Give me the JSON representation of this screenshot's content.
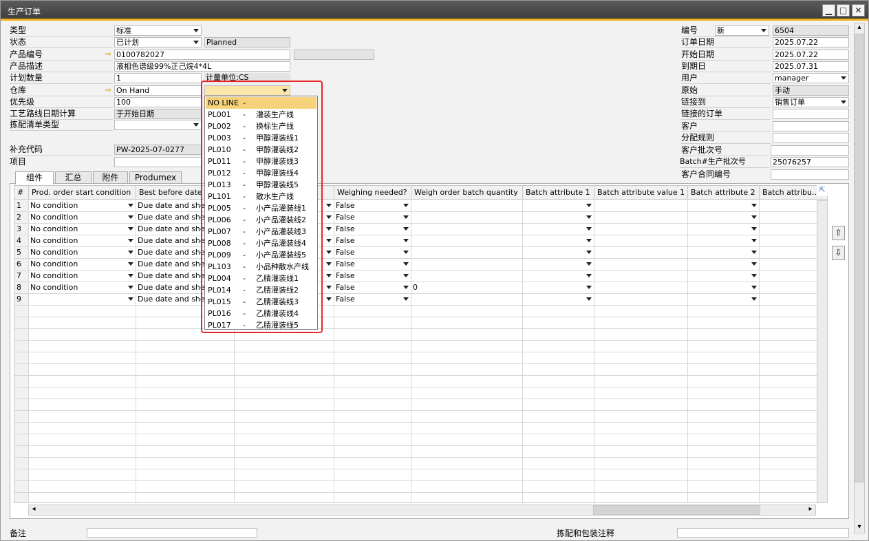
{
  "window": {
    "title": "生产订单",
    "minimize": "▁",
    "maximize": "□",
    "close": "✕"
  },
  "left_form": {
    "type_label": "类型",
    "type_value": "标准",
    "status_label": "状态",
    "status_value": "已计划",
    "status_text": "Planned",
    "product_no_label": "产品编号",
    "product_no_value": "0100782027",
    "product_desc_label": "产品描述",
    "product_desc_value": "液相色谱级99%正己烷4*4L",
    "planned_qty_label": "计划数量",
    "planned_qty_value": "1",
    "uom_label": "计量单位:CS",
    "warehouse_label": "仓库",
    "warehouse_value": "On Hand",
    "priority_label": "优先级",
    "priority_value": "100",
    "routing_date_label": "工艺路线日期计算",
    "routing_date_value": "于开始日期",
    "picklist_label": "拣配清单类型",
    "picklist_value": "",
    "supplement_label": "补充代码",
    "supplement_value": "PW-2025-07-0277",
    "project_label": "项目",
    "project_value": ""
  },
  "right_form": {
    "number_label": "编号",
    "series_value": "新",
    "number_value": "6504",
    "order_date_label": "订单日期",
    "order_date_value": "2025.07.22",
    "start_date_label": "开始日期",
    "start_date_value": "2025.07.22",
    "due_date_label": "到期日",
    "due_date_value": "2025.07.31",
    "user_label": "用户",
    "user_value": "manager",
    "origin_label": "原始",
    "origin_value": "手动",
    "link_to_label": "链接到",
    "link_to_value": "销售订单",
    "linked_order_label": "链接的订单",
    "linked_order_value": "",
    "customer_label": "客户",
    "customer_value": "",
    "dist_rule_label": "分配规则",
    "dist_rule_value": "",
    "cust_batch_label": "客户批次号",
    "cust_batch_value": "",
    "prod_batch_label": "Batch#生产批次号",
    "prod_batch_value": "25076257",
    "contract_label": "客户合同编号",
    "contract_value": ""
  },
  "tabs": [
    "组件",
    "汇总",
    "附件",
    "Produmex"
  ],
  "grid": {
    "headers": [
      "#",
      "Prod. order start condition",
      "Best before date o",
      "",
      "Weighing needed?",
      "Weigh order batch quantity",
      "Batch attribute 1",
      "Batch attribute value 1",
      "Batch attribute 2",
      "Batch attribu…"
    ],
    "rows": [
      {
        "num": "1",
        "cond": "No condition",
        "bbd": "Due date and shelf li",
        "weigh": "False",
        "qty": ""
      },
      {
        "num": "2",
        "cond": "No condition",
        "bbd": "Due date and shelf li",
        "weigh": "False",
        "qty": ""
      },
      {
        "num": "3",
        "cond": "No condition",
        "bbd": "Due date and shelf li",
        "weigh": "False",
        "qty": ""
      },
      {
        "num": "4",
        "cond": "No condition",
        "bbd": "Due date and shelf li",
        "weigh": "False",
        "qty": ""
      },
      {
        "num": "5",
        "cond": "No condition",
        "bbd": "Due date and shelf li",
        "weigh": "False",
        "qty": ""
      },
      {
        "num": "6",
        "cond": "No condition",
        "bbd": "Due date and shelf li",
        "weigh": "False",
        "qty": ""
      },
      {
        "num": "7",
        "cond": "No condition",
        "bbd": "Due date and shelf li",
        "weigh": "False",
        "qty": ""
      },
      {
        "num": "8",
        "cond": "No condition",
        "bbd": "Due date and shelf li",
        "weigh": "False",
        "qty": "0"
      },
      {
        "num": "9",
        "cond": "",
        "bbd": "Due date and shelf li",
        "weigh": "False",
        "qty": ""
      }
    ]
  },
  "dropdown": {
    "items": [
      {
        "code": "NO LINE",
        "dash": "-",
        "name": ""
      },
      {
        "code": "PL001",
        "dash": "-",
        "name": "灌装生产线"
      },
      {
        "code": "PL002",
        "dash": "-",
        "name": "换标生产线"
      },
      {
        "code": "PL003",
        "dash": "-",
        "name": "甲醇灌装线1"
      },
      {
        "code": "PL010",
        "dash": "-",
        "name": "甲醇灌装线2"
      },
      {
        "code": "PL011",
        "dash": "-",
        "name": "甲醇灌装线3"
      },
      {
        "code": "PL012",
        "dash": "-",
        "name": "甲醇灌装线4"
      },
      {
        "code": "PL013",
        "dash": "-",
        "name": "甲醇灌装线5"
      },
      {
        "code": "PL101",
        "dash": "-",
        "name": "散水生产线"
      },
      {
        "code": "PL005",
        "dash": "-",
        "name": "小产品灌装线1"
      },
      {
        "code": "PL006",
        "dash": "-",
        "name": "小产品灌装线2"
      },
      {
        "code": "PL007",
        "dash": "-",
        "name": "小产品灌装线3"
      },
      {
        "code": "PL008",
        "dash": "-",
        "name": "小产品灌装线4"
      },
      {
        "code": "PL009",
        "dash": "-",
        "name": "小产品灌装线5"
      },
      {
        "code": "PL103",
        "dash": "-",
        "name": "小品种散水产线"
      },
      {
        "code": "PL004",
        "dash": "-",
        "name": "乙腈灌装线1"
      },
      {
        "code": "PL014",
        "dash": "-",
        "name": "乙腈灌装线2"
      },
      {
        "code": "PL015",
        "dash": "-",
        "name": "乙腈灌装线3"
      },
      {
        "code": "PL016",
        "dash": "-",
        "name": "乙腈灌装线4"
      },
      {
        "code": "PL017",
        "dash": "-",
        "name": "乙腈灌装线5"
      }
    ]
  },
  "footer": {
    "remarks_label": "备注",
    "pick_pack_label": "拣配和包装注释"
  },
  "icons": {
    "link_arrow": "⇨",
    "move_up": "⇧",
    "move_down": "⇩",
    "expand": "⇱",
    "scroll_left": "◂",
    "scroll_right": "▸",
    "scroll_up": "▴",
    "scroll_down": "▾"
  },
  "colors": {
    "title_bg": "#4a4a4a",
    "accent": "#f0b11d",
    "selected_row": "#f6d37a",
    "highlight_box": "#e8262a"
  }
}
